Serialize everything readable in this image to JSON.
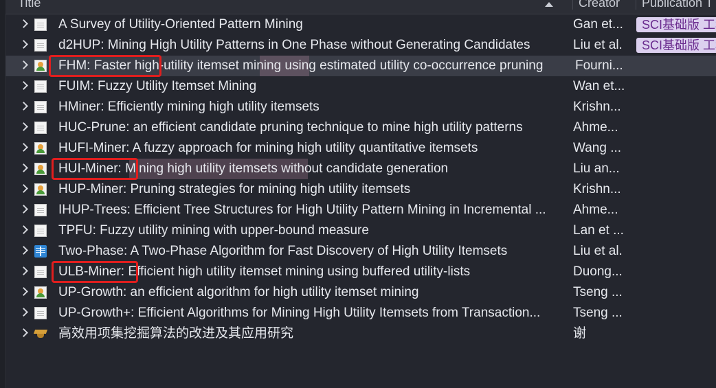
{
  "header": {
    "title": "Title",
    "creator": "Creator",
    "publication": "Publication T"
  },
  "rows": [
    {
      "title": "A Survey of Utility-Oriented Pattern Mining",
      "creator": "Gan et...",
      "publication": "SCI基础版 工程",
      "icon": "document-icon"
    },
    {
      "title": "d2HUP: Mining High Utility Patterns in One Phase without Generating Candidates",
      "creator": "Liu et al.",
      "publication": "SCI基础版 工程",
      "icon": "document-icon"
    },
    {
      "title": "FHM: Faster high-utility itemset mining using estimated utility co-occurrence pruning",
      "creator": "Fourni...",
      "publication": "",
      "icon": "person-document-icon"
    },
    {
      "title": "FUIM: Fuzzy Utility Itemset Mining",
      "creator": "Wan et...",
      "publication": "",
      "icon": "document-icon"
    },
    {
      "title": "HMiner: Efficiently mining high utility itemsets",
      "creator": "Krishn...",
      "publication": "",
      "icon": "document-icon"
    },
    {
      "title": "HUC-Prune: an efficient candidate pruning technique to mine high utility patterns",
      "creator": "Ahme...",
      "publication": "",
      "icon": "document-icon"
    },
    {
      "title": "HUFI-Miner: A fuzzy approach for mining high utility quantitative itemsets",
      "creator": "Wang ...",
      "publication": "",
      "icon": "person-document-icon"
    },
    {
      "title": "HUI-Miner: Mining high utility itemsets without candidate generation",
      "creator": "Liu an...",
      "publication": "",
      "icon": "person-document-icon"
    },
    {
      "title": "HUP-Miner: Pruning strategies for mining high utility itemsets",
      "creator": "Krishn...",
      "publication": "",
      "icon": "person-document-icon"
    },
    {
      "title": "IHUP-Trees: Efficient Tree Structures for High Utility Pattern Mining in Incremental ...",
      "creator": "Ahme...",
      "publication": "",
      "icon": "document-icon"
    },
    {
      "title": "TPFU: Fuzzy utility mining with upper-bound measure",
      "creator": "Lan et ...",
      "publication": "",
      "icon": "document-icon"
    },
    {
      "title": "Two-Phase: A Two-Phase Algorithm for Fast Discovery of High Utility Itemsets",
      "creator": "Liu et al.",
      "publication": "",
      "icon": "book-icon"
    },
    {
      "title": "ULB-Miner: Efficient high utility itemset mining using buffered utility-lists",
      "creator": "Duong...",
      "publication": "",
      "icon": "document-icon"
    },
    {
      "title": "UP-Growth: an efficient algorithm for high utility itemset mining",
      "creator": "Tseng ...",
      "publication": "",
      "icon": "person-document-icon"
    },
    {
      "title": "UP-Growth+: Efficient Algorithms for Mining High Utility Itemsets from Transaction...",
      "creator": "Tseng ...",
      "publication": "",
      "icon": "document-icon"
    },
    {
      "title": "高效用项集挖掘算法的改进及其应用研究",
      "creator": "谢",
      "publication": "",
      "icon": "thesis-cap-icon"
    }
  ],
  "selected_row": 2,
  "colors": {
    "background": "#24262e",
    "selected": "#3a3d47",
    "tag_bg": "#dcd0ef",
    "tag_fg": "#6a2b8e",
    "annotation": "#e01e1e"
  }
}
